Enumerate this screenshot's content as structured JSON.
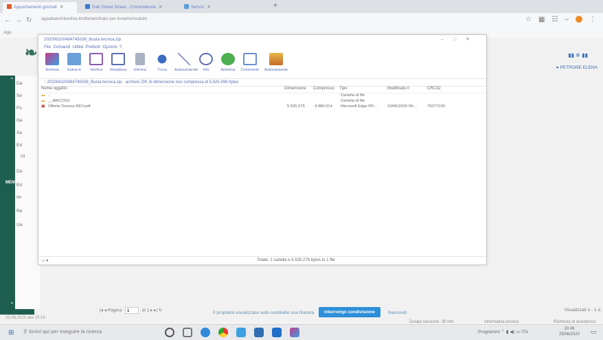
{
  "browser": {
    "tabs": [
      {
        "label": "Appuntamenti giornali",
        "active": true
      },
      {
        "label": "Dati Street Share - Chromebook",
        "active": false
      },
      {
        "label": "Servizi",
        "active": false
      }
    ],
    "url": "appaltatorinlonline.it/offerta/cifrato per inviarlo/modulo",
    "bookmark_label": "App"
  },
  "app": {
    "user_name": "PETRONE ELENA"
  },
  "sidebar": {
    "rows": [
      "Da",
      "Se",
      "Fo",
      "Ge",
      "Sa",
      "Ed",
      "Ul",
      "Da",
      "Ed",
      "Im",
      "Re",
      "Ua"
    ],
    "menu_label": "MENU"
  },
  "winrar": {
    "title": "202006100494745038_Busta tecnica.zip",
    "menu": [
      "File",
      "Comandi",
      "Utilità",
      "Preferiti",
      "Opzioni",
      "?"
    ],
    "toolbar": [
      "Archivia",
      "Estrai in",
      "Verifica",
      "Visualizza",
      "Elimina",
      "Trova",
      "Autoestraente",
      "Info",
      "Antivirus",
      "Commento",
      "Autoestraente"
    ],
    "path": "202006100494745038_Busta tecnica.zip - archivio ZIP, di dimensione non compressa di 5.525.496 bytes",
    "columns": [
      "Nome oggetto",
      "Dimensione",
      "Compresso",
      "Tipo",
      "Modificato il",
      "CRC32"
    ],
    "files": [
      {
        "name": "..",
        "size": "",
        "packed": "",
        "type": "Cartella di file",
        "modified": "",
        "crc": ""
      },
      {
        "name": "__MACOSX",
        "size": "",
        "packed": "",
        "type": "Cartella di file",
        "modified": "",
        "crc": ""
      },
      {
        "name": "Offerta Tecnica REV.pdf",
        "size": "5.525.276",
        "packed": "4.980.014",
        "type": "Microsoft Edge PD...",
        "modified": "10/06/2020 09:...",
        "crc": "75077100"
      }
    ],
    "status_left": "",
    "status_total": "Totale: 1 cartella e 5.525.276 bytes in 1 file"
  },
  "bottom": {
    "page_label": "Pagina",
    "page_value": "1",
    "page_of": "di 1",
    "share_note": "0 proprietà visualizzare sullo condivide una finestra",
    "stop_button": "Interrompi condivisione",
    "hide_link": "Nascondi",
    "results": "Visualizzati 1 - 1 d",
    "footer_date": "25.06.2020 alle 15:18",
    "session": "Durata sessione: 30 min",
    "privacy": "Informativa privacy",
    "request": "Richiesta di assistenza"
  },
  "taskbar": {
    "search": "Scrivi qui per eseguire la ricerca",
    "tray": "Programmi",
    "time": "20:49",
    "date": "25/06/2020"
  }
}
